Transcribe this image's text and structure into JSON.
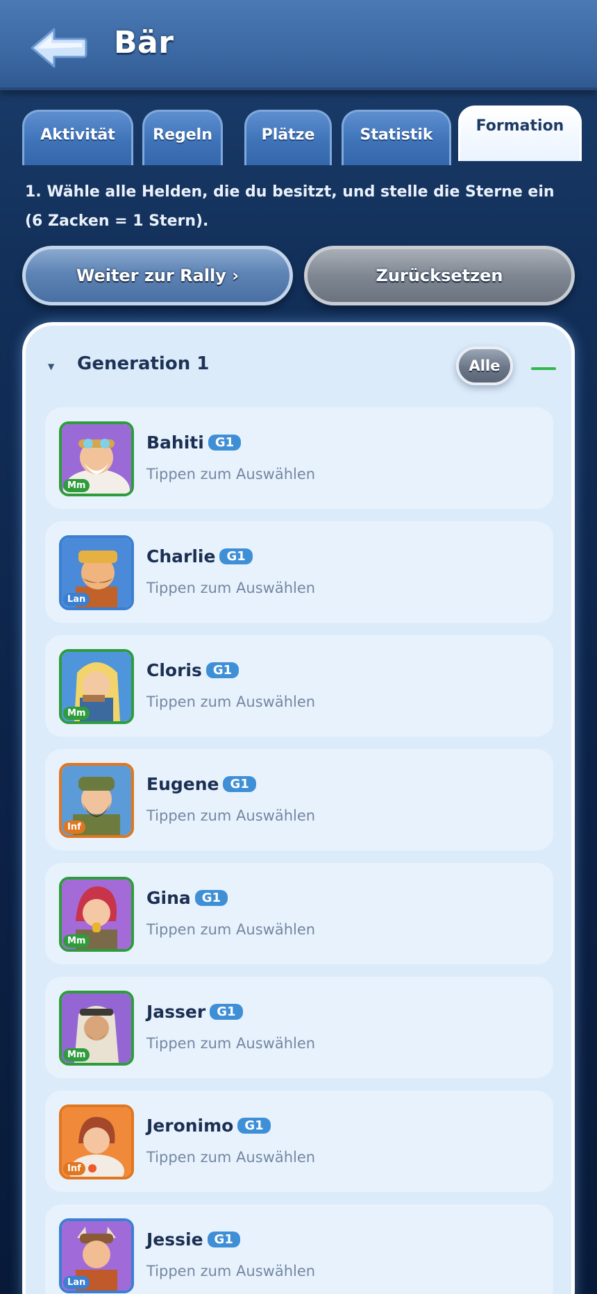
{
  "header": {
    "title": "Bär"
  },
  "tabs": [
    {
      "label": "Aktivität"
    },
    {
      "label": "Regeln"
    },
    {
      "label": "Plätze"
    },
    {
      "label": "Statistik"
    },
    {
      "label": "Formation"
    }
  ],
  "instruction": "1. Wähle alle Helden, die du besitzt, und stelle die Sterne ein (6 Zacken = 1 Stern).",
  "actions": {
    "rally": "Weiter zur Rally ›",
    "reset": "Zurücksetzen"
  },
  "generation": {
    "title": "Generation 1",
    "all_label": "Alle"
  },
  "colors": {
    "mm": "#2e9c3c",
    "lan": "#3b7fd0",
    "inf": "#e0761f"
  },
  "heroes": [
    {
      "name": "Bahiti",
      "gen": "G1",
      "hint": "Tippen zum Auswählen",
      "type": "Mm"
    },
    {
      "name": "Charlie",
      "gen": "G1",
      "hint": "Tippen zum Auswählen",
      "type": "Lan"
    },
    {
      "name": "Cloris",
      "gen": "G1",
      "hint": "Tippen zum Auswählen",
      "type": "Mm"
    },
    {
      "name": "Eugene",
      "gen": "G1",
      "hint": "Tippen zum Auswählen",
      "type": "Inf"
    },
    {
      "name": "Gina",
      "gen": "G1",
      "hint": "Tippen zum Auswählen",
      "type": "Mm"
    },
    {
      "name": "Jasser",
      "gen": "G1",
      "hint": "Tippen zum Auswählen",
      "type": "Mm"
    },
    {
      "name": "Jeronimo",
      "gen": "G1",
      "hint": "Tippen zum Auswählen",
      "type": "Inf"
    },
    {
      "name": "Jessie",
      "gen": "G1",
      "hint": "Tippen zum Auswählen",
      "type": "Lan"
    }
  ]
}
